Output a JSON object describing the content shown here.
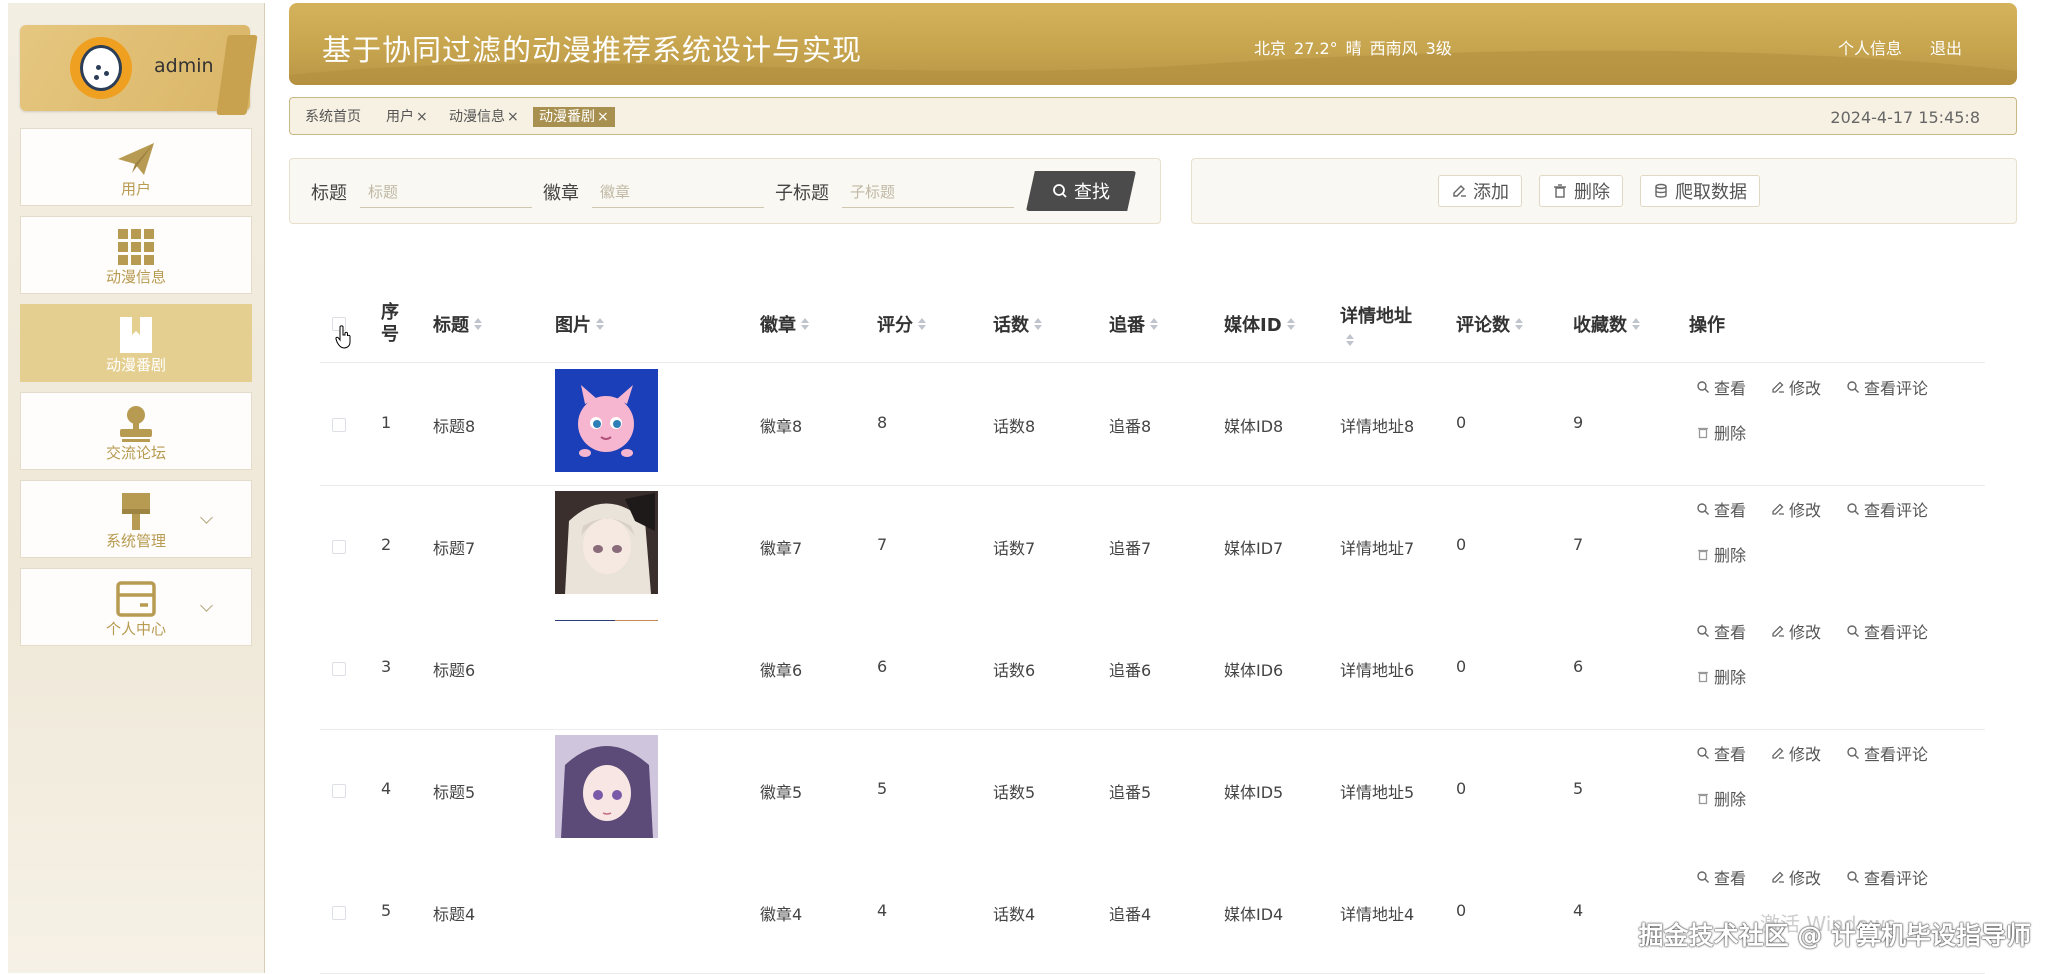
{
  "sidebar": {
    "username": "admin",
    "items": [
      {
        "label": "用户",
        "icon": "paper-plane-icon"
      },
      {
        "label": "动漫信息",
        "icon": "grid-icon"
      },
      {
        "label": "动漫番剧",
        "icon": "book-icon"
      },
      {
        "label": "交流论坛",
        "icon": "user-stamp-icon"
      },
      {
        "label": "系统管理",
        "icon": "brush-icon"
      },
      {
        "label": "个人中心",
        "icon": "card-icon"
      }
    ]
  },
  "header": {
    "title": "基于协同过滤的动漫推荐系统设计与实现",
    "weather": {
      "city": "北京",
      "temp": "27.2°",
      "condition": "晴",
      "wind": "西南风",
      "level": "3级"
    },
    "profile_link": "个人信息",
    "logout_link": "退出"
  },
  "tabs": [
    {
      "label": "系统首页"
    },
    {
      "label": "用户"
    },
    {
      "label": "动漫信息"
    },
    {
      "label": "动漫番剧"
    }
  ],
  "datetime": "2024-4-17 15:45:8",
  "search": {
    "title_label": "标题",
    "title_placeholder": "标题",
    "badge_label": "徽章",
    "badge_placeholder": "徽章",
    "subtitle_label": "子标题",
    "subtitle_placeholder": "子标题",
    "button": "查找"
  },
  "actions": {
    "add": "添加",
    "delete": "删除",
    "crawl": "爬取数据"
  },
  "table": {
    "headers": {
      "index": "序号",
      "title": "标题",
      "image": "图片",
      "badge": "徽章",
      "score": "评分",
      "episodes": "话数",
      "follow": "追番",
      "media_id": "媒体ID",
      "detail_url": "详情地址",
      "comments": "评论数",
      "favorites": "收藏数",
      "ops": "操作"
    },
    "ops": {
      "view": "查看",
      "edit": "修改",
      "view_comments": "查看评论",
      "delete": "删除"
    },
    "rows": [
      {
        "index": "1",
        "title": "标题8",
        "badge": "徽章8",
        "score": "8",
        "episodes": "话数8",
        "follow": "追番8",
        "media_id": "媒体ID8",
        "detail_url": "详情地址8",
        "comments": "0",
        "favorites": "9"
      },
      {
        "index": "2",
        "title": "标题7",
        "badge": "徽章7",
        "score": "7",
        "episodes": "话数7",
        "follow": "追番7",
        "media_id": "媒体ID7",
        "detail_url": "详情地址7",
        "comments": "0",
        "favorites": "7"
      },
      {
        "index": "3",
        "title": "标题6",
        "badge": "徽章6",
        "score": "6",
        "episodes": "话数6",
        "follow": "追番6",
        "media_id": "媒体ID6",
        "detail_url": "详情地址6",
        "comments": "0",
        "favorites": "6"
      },
      {
        "index": "4",
        "title": "标题5",
        "badge": "徽章5",
        "score": "5",
        "episodes": "话数5",
        "follow": "追番5",
        "media_id": "媒体ID5",
        "detail_url": "详情地址5",
        "comments": "0",
        "favorites": "5"
      },
      {
        "index": "5",
        "title": "标题4",
        "badge": "徽章4",
        "score": "4",
        "episodes": "话数4",
        "follow": "追番4",
        "media_id": "媒体ID4",
        "detail_url": "详情地址4",
        "comments": "0",
        "favorites": "4"
      }
    ]
  },
  "watermark": "掘金技术社区 @ 计算机毕设指导师",
  "windows_activation": "激活 Windows",
  "theme": {
    "accent": "#c9a651",
    "active_nav": "#e4cf90",
    "tab_active": "#a89050"
  }
}
